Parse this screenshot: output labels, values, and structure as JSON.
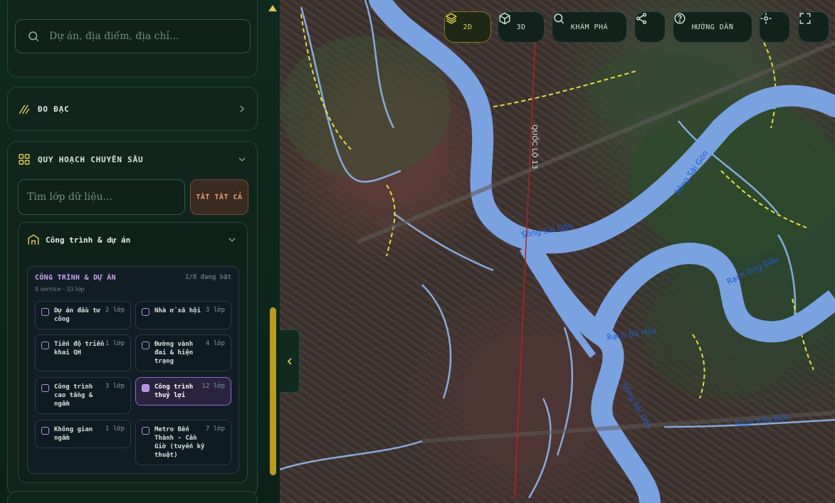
{
  "sidebar": {
    "search": {
      "placeholder": "Dự án, địa điểm, địa chỉ..."
    },
    "measure": {
      "label": "ĐO ĐẠC",
      "icon": "ruler-icon"
    },
    "planning": {
      "label": "QUY HOẠCH CHUYÊN SÂU",
      "icon": "grid-icon",
      "layer_search_placeholder": "Tìm lớp dữ liệu...",
      "clear_all_label": "TẮT TẤT CẢ",
      "group": {
        "label": "Công trình & dự án",
        "icon": "building-icon",
        "panel": {
          "title": "CÔNG TRÌNH & DỰ ÁN",
          "status": "1/8 đang bật",
          "subtitle": "8 service · 33 lớp",
          "items": [
            {
              "name": "Dự án đầu tư công",
              "count": "2 lớp",
              "active": false
            },
            {
              "name": "Nhà ở xã hội",
              "count": "3 lớp",
              "active": false
            },
            {
              "name": "Tiến độ triển khai QH",
              "count": "1 lớp",
              "active": false
            },
            {
              "name": "Đường vành đai & hiện trạng",
              "count": "4 lớp",
              "active": false
            },
            {
              "name": "Công trình cao tầng & ngầm",
              "count": "3 lớp",
              "active": false
            },
            {
              "name": "Công trình thuỷ lợi",
              "count": "12 lớp",
              "active": true
            },
            {
              "name": "Không gian ngầm",
              "count": "1 lớp",
              "active": false
            },
            {
              "name": "Metro Bến Thành - Cần Giờ (tuyến kỹ thuật)",
              "count": "7 lớp",
              "active": false
            }
          ]
        }
      }
    }
  },
  "toolbar": {
    "view_2d": "2D",
    "view_3d": "3D",
    "explore": "KHÁM PHÁ",
    "guide": "HƯỚNG DẪN"
  },
  "map": {
    "labels": {
      "river1": "Sông Sài Gòn",
      "river2": "Sông Sài Gòn",
      "river3": "Sông Sài Gòn",
      "highway": "QUỐC LỘ 13",
      "canal1": "Rạch Cầu Đúc",
      "canal2": "Rạch Bà Hoa",
      "canal3": "Rạch Ông Đầu"
    }
  },
  "colors": {
    "accent": "#d9c84a",
    "active_layer": "#b690e0",
    "river": "#7aa2e0",
    "clear_button": "#e0a077"
  }
}
